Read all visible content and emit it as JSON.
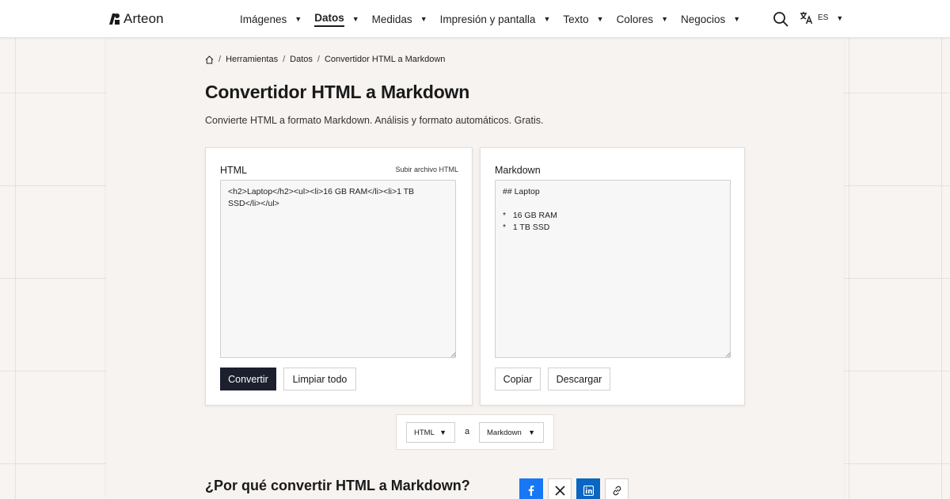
{
  "brand": {
    "name": "Arteon"
  },
  "nav": {
    "items": [
      {
        "label": "Imágenes",
        "active": false
      },
      {
        "label": "Datos",
        "active": true
      },
      {
        "label": "Medidas",
        "active": false
      },
      {
        "label": "Impresión y pantalla",
        "active": false
      },
      {
        "label": "Texto",
        "active": false
      },
      {
        "label": "Colores",
        "active": false
      },
      {
        "label": "Negocios",
        "active": false
      }
    ],
    "caret": "▼",
    "search_icon": "search-icon",
    "language": {
      "code": "ES",
      "icon": "translate-icon"
    }
  },
  "breadcrumb": {
    "home_icon": "home-icon",
    "separator": "/",
    "items": [
      "Herramientas",
      "Datos"
    ],
    "current": "Convertidor HTML a Markdown"
  },
  "page": {
    "title": "Convertidor HTML a Markdown",
    "subtitle": "Convierte HTML a formato Markdown. Análisis y formato automáticos. Gratis."
  },
  "input_card": {
    "label": "HTML",
    "upload_label": "Subir archivo HTML",
    "value": "<h2>Laptop</h2><ul><li>16 GB RAM</li><li>1 TB SSD</li></ul>",
    "convert_label": "Convertir",
    "clear_label": "Limpiar todo"
  },
  "output_card": {
    "label": "Markdown",
    "value": "## Laptop\n\n*   16 GB RAM\n*   1 TB SSD",
    "copy_label": "Copiar",
    "download_label": "Descargar"
  },
  "format_bar": {
    "from": "HTML",
    "connector": "a",
    "to": "Markdown"
  },
  "why_section": {
    "title": "¿Por qué convertir HTML a Markdown?"
  },
  "share": {
    "icons": [
      "facebook-icon",
      "x-icon",
      "linkedin-icon",
      "link-icon"
    ],
    "colors": {
      "facebook": "#1877f2",
      "linkedin": "#0a66c2"
    }
  },
  "colors": {
    "primary_button": "#1c1f2e",
    "background": "#f7f4f1"
  }
}
